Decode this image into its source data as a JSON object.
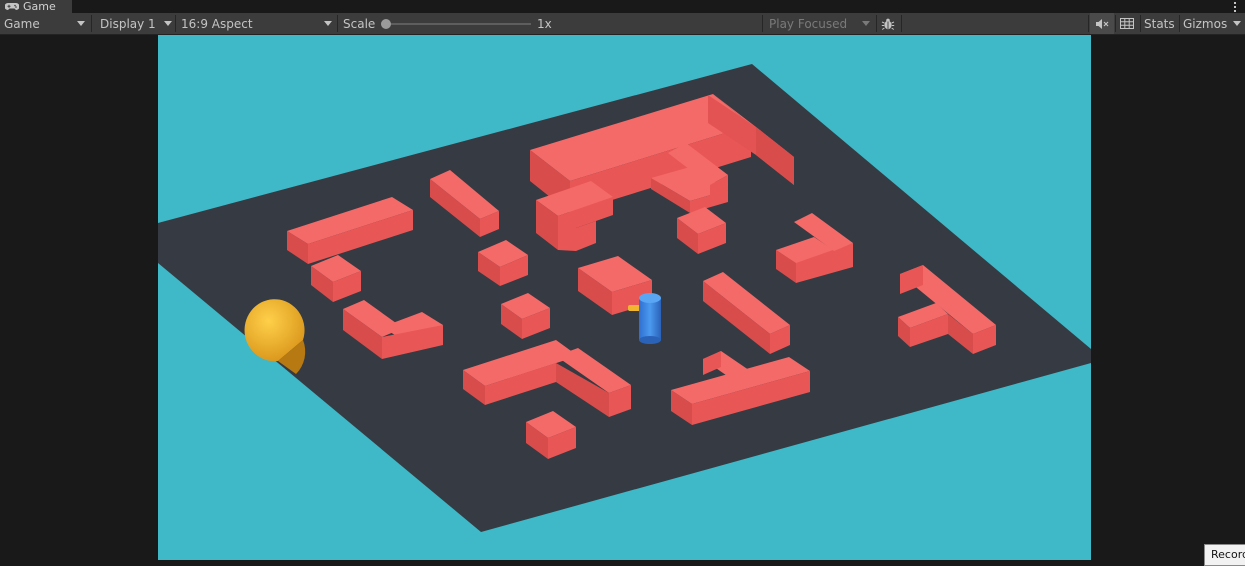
{
  "window": {
    "tab_title": "Game",
    "tab_icon": "gamepad-icon",
    "menu_icon": "kebab-menu-icon"
  },
  "toolbar": {
    "view_dropdown": "Game",
    "display_dropdown": "Display 1",
    "aspect_dropdown": "16:9 Aspect",
    "scale_label": "Scale",
    "scale_value": "1x",
    "scale_level": 0,
    "play_mode_dropdown": "Play Focused",
    "bug_icon": "bug-icon",
    "audio_icon": "audio-mute-icon",
    "grid_icon": "grid-icon",
    "stats_label": "Stats",
    "gizmos_label": "Gizmos"
  },
  "scene": {
    "background_color": "#3fb8c7",
    "floor_color": "#363a42",
    "wall_color": "#e85656",
    "player_color": "#f2b530",
    "enemy_color": "#3a86e6"
  },
  "tooltip": {
    "text": "Recorder"
  }
}
